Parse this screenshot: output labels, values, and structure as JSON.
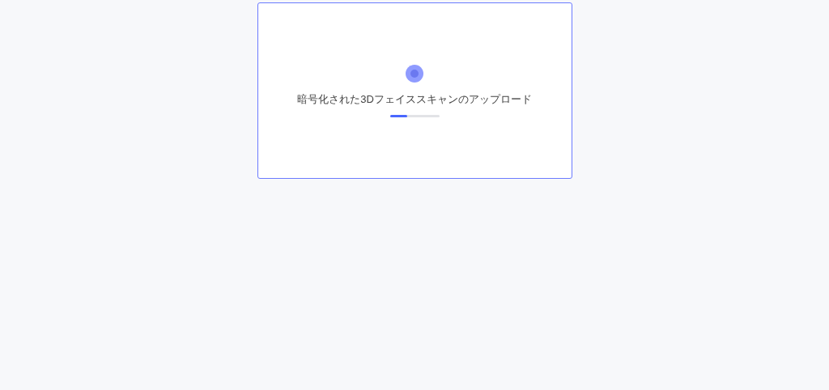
{
  "upload": {
    "message": "暗号化された3Dフェイススキャンのアップロード",
    "level": 0.35
  }
}
